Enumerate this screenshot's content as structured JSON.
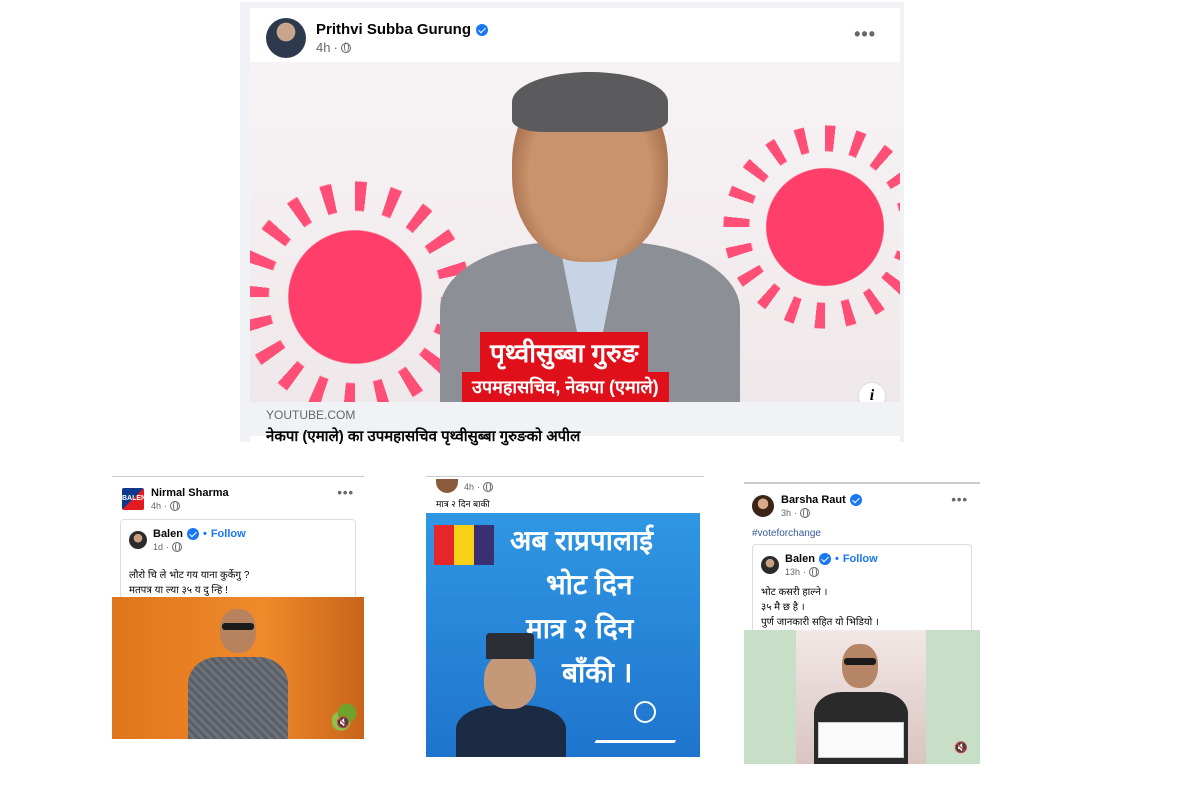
{
  "main_post": {
    "author": "Prithvi Subba Gurung",
    "time": "4h",
    "more": "•••",
    "image_caption_1": "पृथ्वीसुब्बा गुरुङ",
    "image_caption_2": "उपमहासचिव, नेकपा (एमाले)",
    "info": "i",
    "link_domain": "YOUTUBE.COM",
    "link_title": "नेकपा (एमाले) का उपमहासचिव पृथ्वीसुब्बा गुरुङको अपील"
  },
  "nirmal_post": {
    "author": "Nirmal Sharma",
    "time": "4h",
    "more": "•••",
    "logo_text": "BALEN",
    "shared": {
      "author": "Balen",
      "separator": "•",
      "follow": "Follow",
      "time": "1d",
      "line1": "लौरो चि ले भोट गय याना कुर्केगु ?",
      "line2": "मतपत्र या ल्या ३५ य दु न्हि !"
    },
    "mute": "🔇"
  },
  "middle_post": {
    "time": "4h",
    "text": "मात्र २ दिन बाकी",
    "poster_line1": "अब राप्रपालाई",
    "poster_line2": "भोट दिन",
    "poster_line3": "मात्र २ दिन",
    "poster_line4": "बाँकी ।",
    "flag_colors": [
      "#e5262b",
      "#f7d117",
      "#3a2f73"
    ]
  },
  "barsha_post": {
    "author": "Barsha Raut",
    "time": "3h",
    "more": "•••",
    "hashtag": "#voteforchange",
    "shared": {
      "author": "Balen",
      "separator": "•",
      "follow": "Follow",
      "time": "13h",
      "line1": "भोट कसरी हाल्ने ।",
      "line2": "३५ मै छ है ।",
      "line3": "पुर्ण जानकारी सहित यो भिडियो ।"
    },
    "mute": "🔇"
  },
  "colors": {
    "facebook_blue": "#1877f2",
    "uml_red": "#e0101b",
    "poster_blue": "#1f74cd"
  }
}
